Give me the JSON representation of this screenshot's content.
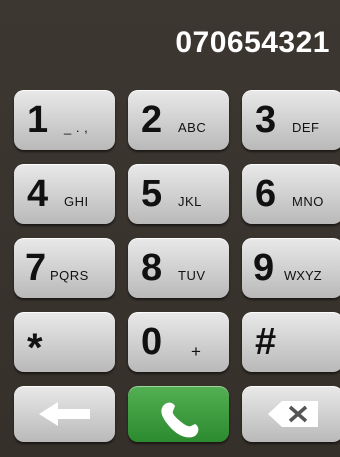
{
  "display": {
    "number": "070654321"
  },
  "keys": [
    {
      "digit": "1",
      "letters": "_ . ,"
    },
    {
      "digit": "2",
      "letters": "ABC"
    },
    {
      "digit": "3",
      "letters": "DEF"
    },
    {
      "digit": "4",
      "letters": "GHI"
    },
    {
      "digit": "5",
      "letters": "JKL"
    },
    {
      "digit": "6",
      "letters": "MNO"
    },
    {
      "digit": "7",
      "letters": "PQRS"
    },
    {
      "digit": "8",
      "letters": "TUV"
    },
    {
      "digit": "9",
      "letters": "WXYZ"
    },
    {
      "digit": "*",
      "letters": ""
    },
    {
      "digit": "0",
      "letters": "+"
    },
    {
      "digit": "#",
      "letters": ""
    }
  ],
  "controls": {
    "back_icon": "left-arrow-icon",
    "call_icon": "phone-handset-icon",
    "delete_icon": "backspace-icon",
    "call_color": "#3a9e3d"
  }
}
